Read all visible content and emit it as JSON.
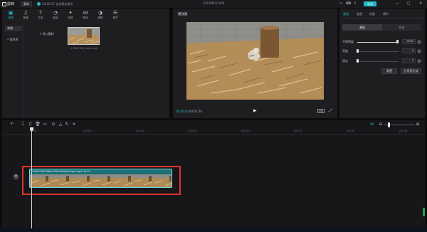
{
  "app": {
    "name": "剪映",
    "menu_label": "菜单",
    "save_status": "14:25:17 自动保存成功",
    "document_title": "202306011424",
    "export_label": "导出"
  },
  "toolbar": {
    "tools": [
      {
        "label": "视频",
        "icon": "video-icon"
      },
      {
        "label": "音频",
        "icon": "audio-icon"
      },
      {
        "label": "文本",
        "icon": "text-icon"
      },
      {
        "label": "贴纸",
        "icon": "sticker-icon"
      },
      {
        "label": "特效",
        "icon": "effects-icon"
      },
      {
        "label": "转场",
        "icon": "transition-icon"
      },
      {
        "label": "滤镜",
        "icon": "filter-icon"
      },
      {
        "label": "调节",
        "icon": "adjust-icon"
      }
    ]
  },
  "media_nav": {
    "items": [
      {
        "label": "本地"
      },
      {
        "label": "• 素材库"
      }
    ]
  },
  "media": {
    "import_label": "导入素材",
    "file_name": "c79b7746_5wei.mp4"
  },
  "player": {
    "title": "播放器",
    "current_time": "00:00:00",
    "duration": "00:01:20",
    "ratio_label": "原始"
  },
  "inspector": {
    "tabs": [
      "画面",
      "变速",
      "动画",
      "调节"
    ],
    "segments": [
      "基础",
      "抠像"
    ],
    "props": [
      {
        "label": "不透明度",
        "value": "100%",
        "level": 1.0
      },
      {
        "label": "亮度",
        "value": "0",
        "level": 0.0
      },
      {
        "label": "锐化",
        "value": "0",
        "level": 0.0
      }
    ],
    "reset_label": "重置",
    "apply_all_label": "应用到全部"
  },
  "timeline": {
    "ruler": [
      "00:00",
      "|00:05",
      "|00:10",
      "|00:15",
      "|00:20",
      "|00:25",
      "|00:30",
      "|00:35"
    ],
    "clip_label": "c79b7746236bec76ec5b0fa5c5wei.mp4   00:19",
    "zoom_level": 0.15
  },
  "colors": {
    "accent": "#1fb8c8",
    "clip": "#21878f",
    "highlight": "#e0322c"
  }
}
